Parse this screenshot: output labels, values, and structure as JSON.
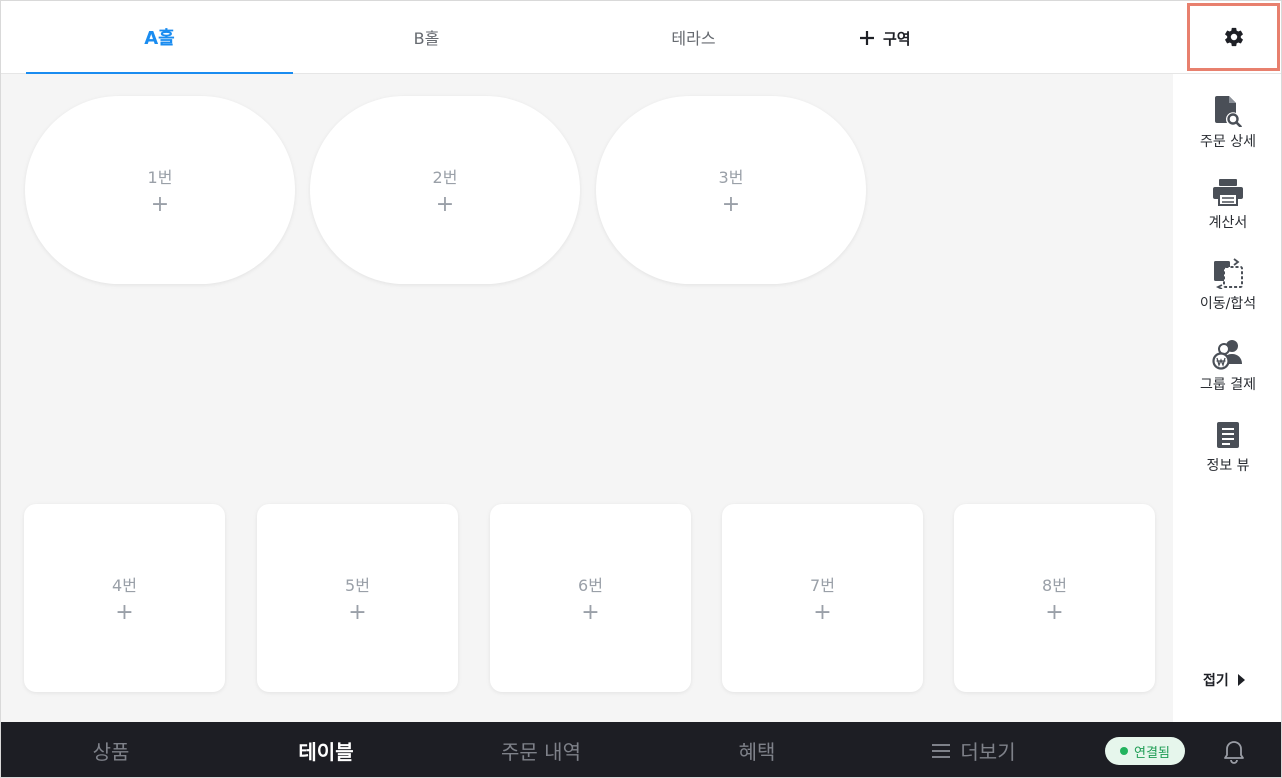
{
  "zones": {
    "tabs": [
      {
        "label": "A홀",
        "active": true
      },
      {
        "label": "B홀",
        "active": false
      },
      {
        "label": "테라스",
        "active": false
      }
    ],
    "add_zone_label": "구역",
    "settings_icon": "gear-icon"
  },
  "side_panel": {
    "items": [
      {
        "label": "주문 상세",
        "icon": "order-detail-search-icon"
      },
      {
        "label": "계산서",
        "icon": "printer-icon"
      },
      {
        "label": "이동/합석",
        "icon": "move-merge-icon"
      },
      {
        "label": "그룹 결제",
        "icon": "group-payment-icon"
      },
      {
        "label": "정보 뷰",
        "icon": "info-document-icon"
      }
    ],
    "collapse_label": "접기"
  },
  "tables": {
    "round": [
      {
        "name": "1번",
        "add": "+"
      },
      {
        "name": "2번",
        "add": "+"
      },
      {
        "name": "3번",
        "add": "+"
      }
    ],
    "square": [
      {
        "name": "4번",
        "add": "+"
      },
      {
        "name": "5번",
        "add": "+"
      },
      {
        "name": "6번",
        "add": "+"
      },
      {
        "name": "7번",
        "add": "+"
      },
      {
        "name": "8번",
        "add": "+"
      }
    ]
  },
  "bottom_nav": {
    "items": [
      {
        "label": "상품",
        "active": false
      },
      {
        "label": "테이블",
        "active": true
      },
      {
        "label": "주문 내역",
        "active": false
      },
      {
        "label": "혜택",
        "active": false
      },
      {
        "label": "더보기",
        "active": false
      }
    ],
    "connection_status": "연결됨",
    "notification_icon": "bell-icon"
  },
  "colors": {
    "accent": "#1a8cf0",
    "highlight_border": "#e8806e",
    "bottom_bar": "#1d1e24",
    "connected": "#22b35e"
  }
}
